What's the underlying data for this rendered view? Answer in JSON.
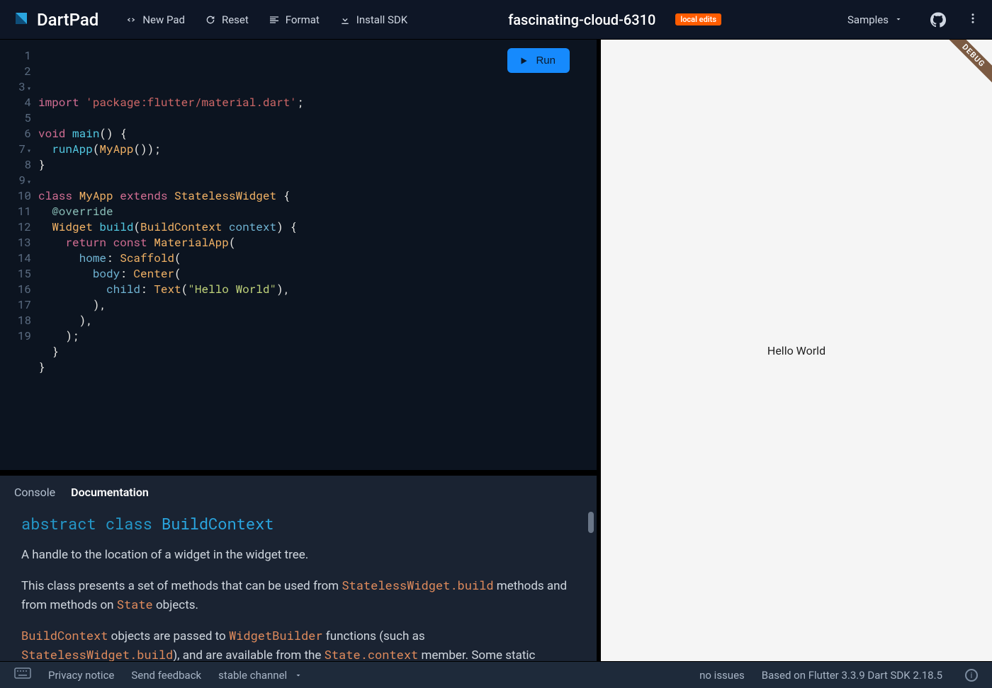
{
  "header": {
    "brand": "DartPad",
    "new_pad": "New Pad",
    "reset": "Reset",
    "format": "Format",
    "install_sdk": "Install SDK",
    "title": "fascinating-cloud-6310",
    "badge": "local edits",
    "samples": "Samples"
  },
  "editor": {
    "run_label": "Run",
    "line_count": 19,
    "fold_lines": [
      3,
      7,
      9
    ],
    "tokens": [
      [
        [
          "k",
          "import "
        ],
        [
          "pk",
          "'package:flutter/material.dart'"
        ],
        [
          "w",
          ";"
        ]
      ],
      [
        [
          "w",
          ""
        ]
      ],
      [
        [
          "k",
          "void "
        ],
        [
          "f",
          "main"
        ],
        [
          "w",
          "() {"
        ]
      ],
      [
        [
          "w",
          "  "
        ],
        [
          "f",
          "runApp"
        ],
        [
          "w",
          "("
        ],
        [
          "t",
          "MyApp"
        ],
        [
          "w",
          "());"
        ]
      ],
      [
        [
          "w",
          "}"
        ]
      ],
      [
        [
          "w",
          ""
        ]
      ],
      [
        [
          "k",
          "class "
        ],
        [
          "t",
          "MyApp "
        ],
        [
          "k",
          "extends "
        ],
        [
          "t",
          "StatelessWidget "
        ],
        [
          "w",
          "{"
        ]
      ],
      [
        [
          "w",
          "  "
        ],
        [
          "at",
          "@override"
        ]
      ],
      [
        [
          "w",
          "  "
        ],
        [
          "t",
          "Widget "
        ],
        [
          "f",
          "build"
        ],
        [
          "w",
          "("
        ],
        [
          "t",
          "BuildContext "
        ],
        [
          "bl",
          "context"
        ],
        [
          "w",
          ") {"
        ]
      ],
      [
        [
          "w",
          "    "
        ],
        [
          "k",
          "return "
        ],
        [
          "k",
          "const "
        ],
        [
          "t",
          "MaterialApp"
        ],
        [
          "w",
          "("
        ]
      ],
      [
        [
          "w",
          "      "
        ],
        [
          "bl",
          "home"
        ],
        [
          "w",
          ": "
        ],
        [
          "t",
          "Scaffold"
        ],
        [
          "w",
          "("
        ]
      ],
      [
        [
          "w",
          "        "
        ],
        [
          "bl",
          "body"
        ],
        [
          "w",
          ": "
        ],
        [
          "t",
          "Center"
        ],
        [
          "w",
          "("
        ]
      ],
      [
        [
          "w",
          "          "
        ],
        [
          "bl",
          "child"
        ],
        [
          "w",
          ": "
        ],
        [
          "t",
          "Text"
        ],
        [
          "w",
          "("
        ],
        [
          "s",
          "\"Hello World\""
        ],
        [
          "w",
          "),"
        ]
      ],
      [
        [
          "w",
          "        ),"
        ]
      ],
      [
        [
          "w",
          "      ),"
        ]
      ],
      [
        [
          "w",
          "    );"
        ]
      ],
      [
        [
          "w",
          "  }"
        ]
      ],
      [
        [
          "w",
          "}"
        ]
      ],
      [
        [
          "w",
          ""
        ]
      ]
    ]
  },
  "preview": {
    "text": "Hello World",
    "debug_label": "DEBUG"
  },
  "tabs": {
    "console": "Console",
    "documentation": "Documentation"
  },
  "doc": {
    "heading_prefix": "abstract class ",
    "heading_name": "BuildContext",
    "p1": "A handle to the location of a widget in the widget tree.",
    "p2_a": "This class presents a set of methods that can be used from ",
    "p2_code1": "StatelessWidget.build",
    "p2_b": " methods and from methods on ",
    "p2_code2": "State",
    "p2_c": " objects.",
    "p3_code1": "BuildContext",
    "p3_a": " objects are passed to ",
    "p3_code2": "WidgetBuilder",
    "p3_b": " functions (such as ",
    "p3_code3": "StatelessWidget.build",
    "p3_c": "), and are available from the ",
    "p3_code4": "State.context",
    "p3_d": " member. Some static"
  },
  "footer": {
    "privacy": "Privacy notice",
    "feedback": "Send feedback",
    "channel": "stable channel",
    "issues": "no issues",
    "sdk": "Based on Flutter 3.3.9 Dart SDK 2.18.5"
  }
}
